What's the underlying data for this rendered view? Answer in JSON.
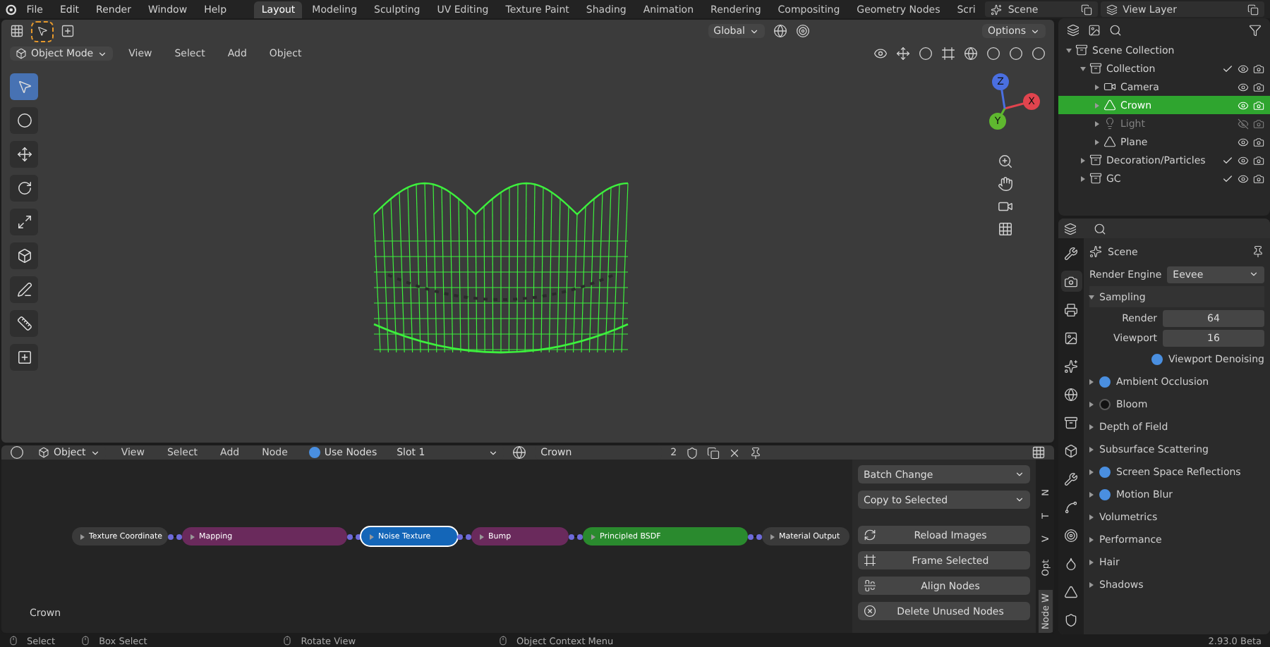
{
  "top_bar": {
    "menus": [
      "File",
      "Edit",
      "Render",
      "Window",
      "Help"
    ],
    "workspaces": [
      {
        "label": "Layout",
        "selected": true
      },
      {
        "label": "Modeling",
        "selected": false
      },
      {
        "label": "Sculpting",
        "selected": false
      },
      {
        "label": "UV Editing",
        "selected": false
      },
      {
        "label": "Texture Paint",
        "selected": false
      },
      {
        "label": "Shading",
        "selected": false
      },
      {
        "label": "Animation",
        "selected": false
      },
      {
        "label": "Rendering",
        "selected": false
      },
      {
        "label": "Compositing",
        "selected": false
      },
      {
        "label": "Geometry Nodes",
        "selected": false
      },
      {
        "label": "Scri",
        "selected": false
      }
    ],
    "scene_field": {
      "value": "Scene"
    },
    "view_layer_field": {
      "value": "View Layer"
    }
  },
  "viewport": {
    "transform_orientation": "Global",
    "options": "Options",
    "mode": "Object Mode",
    "menus": [
      "View",
      "Select",
      "Add",
      "Object"
    ],
    "tools": [
      {
        "selected": true
      },
      {
        "selected": false
      },
      {
        "selected": false
      },
      {
        "selected": false
      },
      {
        "selected": false
      },
      {
        "selected": false
      },
      {
        "selected": false
      },
      {
        "selected": false
      },
      {
        "selected": false
      }
    ],
    "gizmo_axes": [
      "X",
      "Y",
      "Z"
    ]
  },
  "outliner": {
    "items": [
      {
        "label": "Scene Collection",
        "kind": "scene",
        "selected": false,
        "hidden": false,
        "children": [
          {
            "label": "Collection",
            "kind": "collection",
            "selected": false,
            "hidden": false,
            "children": [
              {
                "label": "Camera",
                "kind": "camera",
                "selected": false,
                "hidden": false
              },
              {
                "label": "Crown",
                "kind": "mesh",
                "selected": true,
                "hidden": false
              },
              {
                "label": "Light",
                "kind": "light",
                "selected": false,
                "hidden": true
              },
              {
                "label": "Plane",
                "kind": "mesh",
                "selected": false,
                "hidden": false
              }
            ]
          },
          {
            "label": "Decoration/Particles",
            "kind": "collection",
            "selected": false,
            "hidden": false
          },
          {
            "label": "GC",
            "kind": "collection",
            "selected": false,
            "hidden": false
          }
        ]
      }
    ]
  },
  "properties": {
    "tabs": [
      {
        "selected": false
      },
      {
        "selected": true
      },
      {
        "selected": false
      },
      {
        "selected": false
      },
      {
        "selected": false
      },
      {
        "selected": false
      },
      {
        "selected": false
      },
      {
        "selected": false
      },
      {
        "selected": false
      },
      {
        "selected": false
      },
      {
        "selected": false
      },
      {
        "selected": false
      },
      {
        "selected": false
      },
      {
        "selected": false
      }
    ],
    "context": "Scene",
    "render_engine_label": "Render Engine",
    "render_engine": "Eevee",
    "sampling": {
      "label": "Sampling",
      "expanded": true,
      "render_label": "Render",
      "render": "64",
      "viewport_label": "Viewport",
      "viewport": "16",
      "denoising": {
        "label": "Viewport Denoising",
        "checked": true
      }
    },
    "panels": [
      {
        "label": "Ambient Occlusion",
        "kind": "toggle",
        "checked": true
      },
      {
        "label": "Bloom",
        "kind": "toggle",
        "checked": false
      },
      {
        "label": "Depth of Field",
        "kind": "plain"
      },
      {
        "label": "Subsurface Scattering",
        "kind": "plain"
      },
      {
        "label": "Screen Space Reflections",
        "kind": "toggle",
        "checked": true
      },
      {
        "label": "Motion Blur",
        "kind": "toggle",
        "checked": true
      },
      {
        "label": "Volumetrics",
        "kind": "plain"
      },
      {
        "label": "Performance",
        "kind": "plain"
      },
      {
        "label": "Hair",
        "kind": "plain"
      },
      {
        "label": "Shadows",
        "kind": "plain"
      }
    ]
  },
  "node_editor": {
    "mode": "Object",
    "menus": [
      "View",
      "Select",
      "Add",
      "Node"
    ],
    "use_nodes": {
      "label": "Use Nodes",
      "checked": true
    },
    "slot": "Slot 1",
    "material": "Crown",
    "users": "2",
    "nodes": [
      {
        "title": "Texture Coordinate",
        "color": "#3a3a3a",
        "selected": false
      },
      {
        "title": "Mapping",
        "color": "#6a2a5c",
        "selected": false
      },
      {
        "title": "Noise Texture",
        "color": "#1466b8",
        "selected": true
      },
      {
        "title": "Bump",
        "color": "#6a2a5c",
        "selected": false
      },
      {
        "title": "Principled BSDF",
        "color": "#2a8a2e",
        "selected": false
      },
      {
        "title": "Material Output",
        "color": "#3a3a3a",
        "selected": false
      }
    ],
    "canvas_label": "Crown",
    "side_panel": {
      "dropdowns": [
        "Batch Change",
        "Copy to Selected"
      ],
      "buttons": [
        {
          "label": "Reload Images",
          "kind": "reload"
        },
        {
          "label": "Frame Selected",
          "kind": "frame"
        },
        {
          "label": "Align Nodes",
          "kind": "align"
        },
        {
          "label": "Delete Unused Nodes",
          "kind": "delete"
        }
      ]
    },
    "side_tabs": [
      {
        "label": "N",
        "selected": false
      },
      {
        "label": "T",
        "selected": false
      },
      {
        "label": "V",
        "selected": false
      },
      {
        "label": "Opt",
        "selected": false
      },
      {
        "label": "Node W",
        "selected": true
      }
    ]
  },
  "status_bar": {
    "hints": [
      "Select",
      "Box Select",
      "Rotate View",
      "Object Context Menu"
    ],
    "version": "2.93.0 Beta"
  }
}
